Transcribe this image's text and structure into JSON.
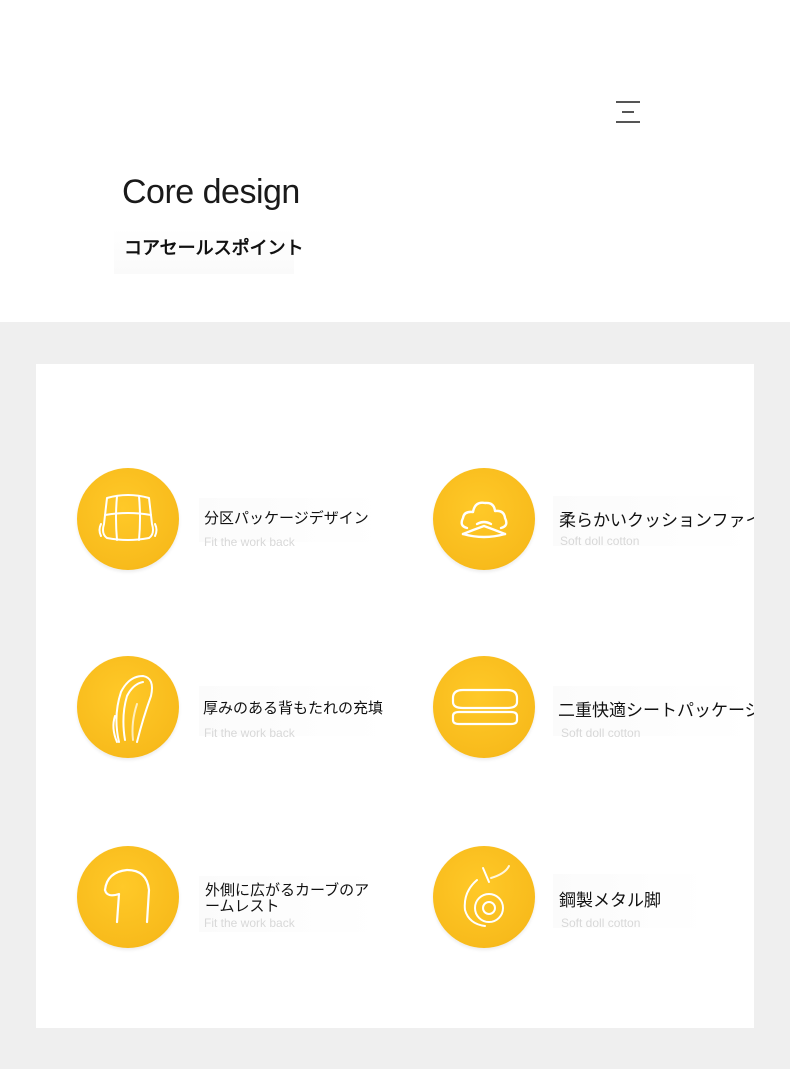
{
  "header": {
    "menu_icon": "menu-icon",
    "title": "Core design",
    "subtitle": "コアセールスポイント"
  },
  "features": [
    {
      "name": "分区パッケージデザイン",
      "sub": "Fit the work back",
      "icon": "seat-cushion-icon"
    },
    {
      "name": "柔らかいクッションファイバー",
      "sub": "Soft doll cotton",
      "icon": "cotton-icon"
    },
    {
      "name": "厚みのある背もたれの充填",
      "sub": "Fit the work back",
      "icon": "backrest-icon"
    },
    {
      "name": "二重快適シートパッケージ",
      "sub": "Soft doll cotton",
      "icon": "double-seat-icon"
    },
    {
      "name": "外側に広がるカーブのアームレスト",
      "sub": "Fit the work back",
      "icon": "armrest-icon"
    },
    {
      "name": "鋼製メタル脚",
      "sub": "Soft doll cotton",
      "icon": "caster-wheel-icon"
    }
  ],
  "colors": {
    "accent": "#f8bb1c",
    "background": "#efefef",
    "panel": "#ffffff",
    "subtext": "#d8d8d8"
  }
}
